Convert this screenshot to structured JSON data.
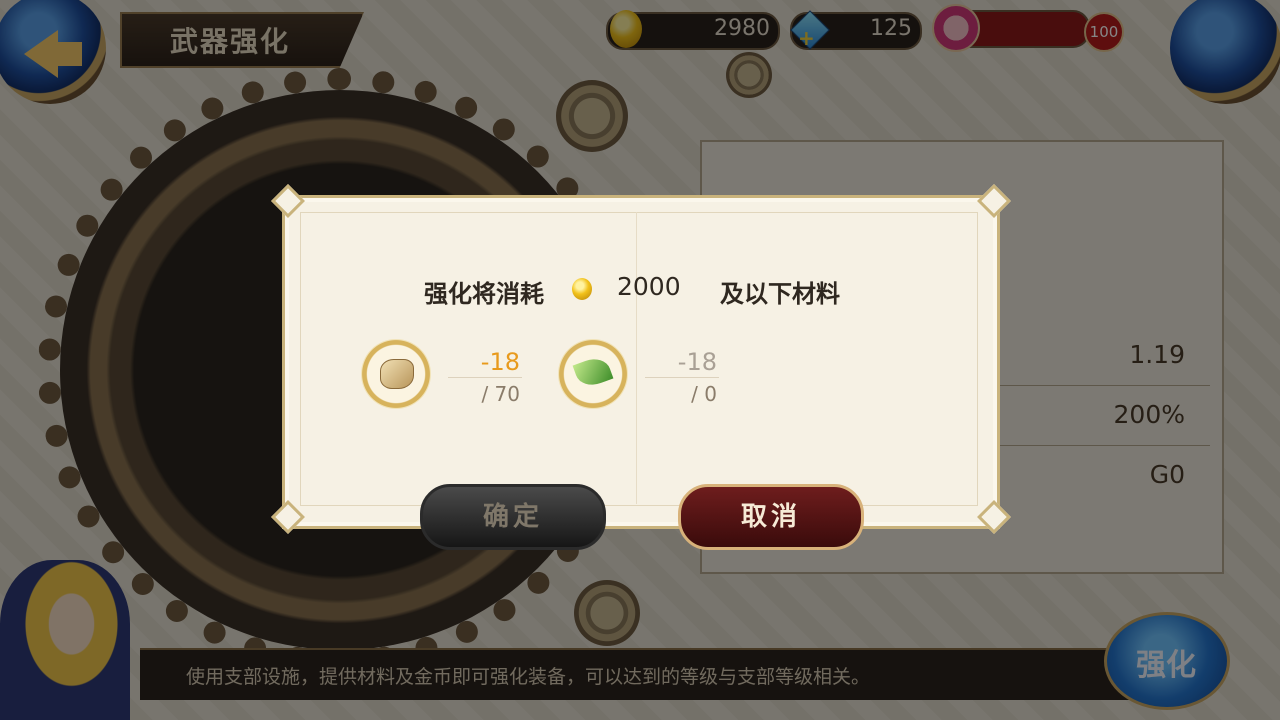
{
  "header": {
    "title": "武器强化",
    "gold": "2980",
    "gems": "125",
    "level": "100"
  },
  "stats": [
    "1.19",
    "200%",
    "G0"
  ],
  "dialog": {
    "cost_label": "强化将消耗",
    "cost_amount": "2000",
    "cost_suffix": "及以下材料",
    "materials": [
      {
        "icon": "stone-material-icon",
        "need": "-18",
        "have": "/ 70",
        "need_color": "#e89a1c"
      },
      {
        "icon": "leaf-material-icon",
        "need": "-18",
        "have": "/ 0",
        "need_color": "#a9a095"
      }
    ],
    "confirm_label": "确定",
    "cancel_label": "取消"
  },
  "footer": {
    "hint": "使用支部设施，提供材料及金币即可强化装备，可以达到的等级与支部等级相关。",
    "enhance_label": "强化"
  }
}
